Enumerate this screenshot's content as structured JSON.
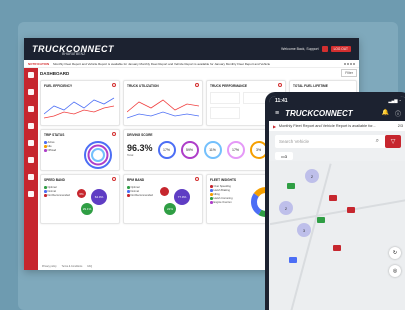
{
  "app": {
    "logo": "TRUCKCONNECT",
    "logo_sub": "BHARATBENZ",
    "welcome": "Welcome Back, Support",
    "logout": "LOG OUT"
  },
  "notification": {
    "tag": "NOTIFICATION",
    "text": "Monthly Fleet Report and Vehicle Report is available for January Monthly Fleet Report and Vehicle Report is available for January Monthly Fleet Report and Vehicle"
  },
  "dashboard": {
    "title": "DASHBOARD",
    "filter": "Filter",
    "cards": {
      "fuel": {
        "title": "FUEL EFFICIENCY"
      },
      "truck_util": {
        "title": "TRUCK UTILIZATION"
      },
      "truck_perf": {
        "title": "TRUCK PERFORMANCE"
      },
      "lifetime": {
        "title": "TOTAL FUEL LIFETIME"
      },
      "trip": {
        "title": "TRIP STATUS",
        "legend": [
          "Active",
          "Idle",
          "Offroad"
        ]
      },
      "driving": {
        "title": "DRIVING SCORE",
        "score": "96.3%",
        "score_label": "Total",
        "rings": [
          "17%",
          "59%",
          "11%",
          "17%",
          "3%"
        ]
      },
      "speed": {
        "title": "SPEED BAND",
        "legend": [
          "Optimal",
          "Normal",
          "Not Recommended"
        ],
        "bubbles": [
          "64.9%",
          "29.1%",
          "6%"
        ]
      },
      "rpm": {
        "title": "RPM BAND",
        "legend": [
          "Optimal",
          "Normal",
          "Not Recommended"
        ],
        "bubbles": [
          "77.9%",
          "22%"
        ]
      },
      "insights": {
        "title": "FLEET INSIGHTS",
        "items": [
          "Over Speeding",
          "Harsh Braking",
          "Idling",
          "Harsh Cornering",
          "Engine Overrun"
        ]
      }
    },
    "footer": [
      "Privacy policy",
      "Terms & Conditions",
      "FAQ"
    ],
    "footer_right": "For Support - 1800 103 0600"
  },
  "phone": {
    "time": "11:41",
    "logo": "TRUCKCONNECT",
    "notif": "Monthly Fleet Report and Vehicle Report is available for...",
    "page": "2/3",
    "search_placeholder": "Search Vehicle",
    "chip": "3",
    "clusters": [
      "2",
      "2",
      "3"
    ]
  }
}
